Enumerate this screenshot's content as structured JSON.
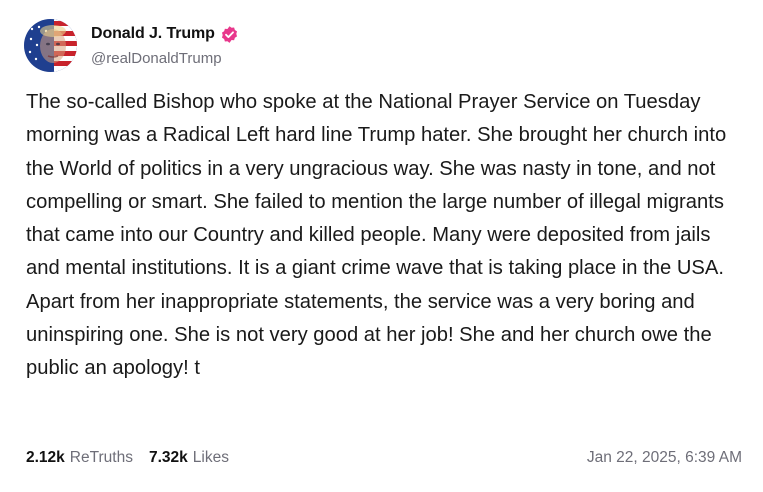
{
  "author": {
    "display_name": "Donald J. Trump",
    "handle": "@realDonaldTrump",
    "verified": true,
    "avatar_icon": "avatar-flag-portrait",
    "verified_color": "#e8388c"
  },
  "post": {
    "text": "The so-called Bishop who spoke at the National Prayer Service on Tuesday morning was a Radical Left hard line Trump hater. She brought her church into the World of politics in a very ungracious way. She was nasty in tone, and not compelling or smart. She failed to mention the large number of illegal migrants that came into our Country and killed people. Many were deposited from jails and mental institutions. It is a giant crime wave that is taking place in the USA. Apart from her inappropriate statements, the service was a very boring and uninspiring one. She is not very good at her job! She and her church owe the public an apology! t"
  },
  "stats": {
    "retruths_count": "2.12k",
    "retruths_label": "ReTruths",
    "likes_count": "7.32k",
    "likes_label": "Likes"
  },
  "timestamp": "Jan 22, 2025, 6:39 AM"
}
